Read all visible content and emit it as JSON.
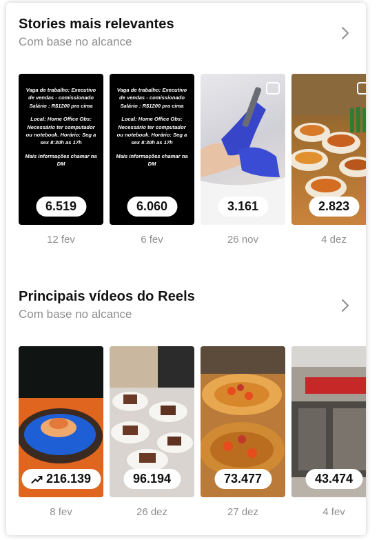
{
  "stories": {
    "title": "Stories mais relevantes",
    "subtitle": "Com base no alcance",
    "items": [
      {
        "value": "6.519",
        "date": "12 fev"
      },
      {
        "value": "6.060",
        "date": "6 fev"
      },
      {
        "value": "3.161",
        "date": "26 nov"
      },
      {
        "value": "2.823",
        "date": "4 dez"
      }
    ],
    "job_post": {
      "line1": "Vaga de trabalho: Executivo de vendas - comissionado Salário : R$1200 pra cima",
      "line2": "Local: Home Office Obs: Necessário ter computador ou notebook. Horário: Seg a sex 8:30h as 17h",
      "line3": "Mais informações chamar na DM"
    }
  },
  "reels": {
    "title": "Principais vídeos do Reels",
    "subtitle": "Com base no alcance",
    "items": [
      {
        "value": "216.139",
        "date": "8 fev",
        "trending": true
      },
      {
        "value": "96.194",
        "date": "26 dez"
      },
      {
        "value": "73.477",
        "date": "27 dez"
      },
      {
        "value": "43.474",
        "date": "4 fev"
      }
    ]
  },
  "colors": {
    "title": "#111111",
    "muted": "#8e8e8e",
    "pill_bg": "#ffffff"
  },
  "icons": {
    "chevron": "chevron-right-icon",
    "trending": "trending-up-icon"
  }
}
